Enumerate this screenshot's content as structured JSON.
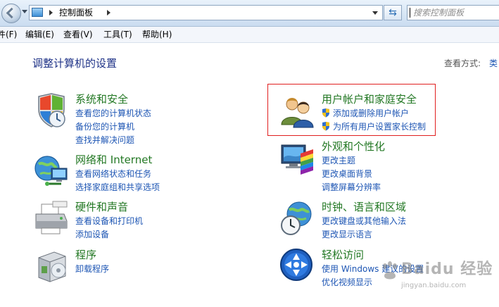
{
  "address_bar": {
    "breadcrumb": [
      "控制面板"
    ],
    "search_placeholder": "搜索控制面板"
  },
  "menu": {
    "file": "件(F)",
    "edit": "编辑(E)",
    "view": "查看(V)",
    "tools": "工具(T)",
    "help": "帮助(H)"
  },
  "main": {
    "title": "调整计算机的设置",
    "view_by_label": "查看方式:",
    "view_by_value": "类",
    "categories": [
      {
        "title": "系统和安全",
        "icon": "shield-icon",
        "links": [
          "查看您的计算机状态",
          "备份您的计算机",
          "查找并解决问题"
        ]
      },
      {
        "title": "网络和 Internet",
        "icon": "network-globe-icon",
        "links": [
          "查看网络状态和任务",
          "选择家庭组和共享选项"
        ]
      },
      {
        "title": "硬件和声音",
        "icon": "printer-icon",
        "links": [
          "查看设备和打印机",
          "添加设备"
        ]
      },
      {
        "title": "程序",
        "icon": "programs-box-icon",
        "links": [
          "卸载程序"
        ]
      },
      {
        "title": "用户帐户和家庭安全",
        "icon": "users-icon",
        "links": [
          "添加或删除用户帐户",
          "为所有用户设置家长控制"
        ]
      },
      {
        "title": "外观和个性化",
        "icon": "monitor-palette-icon",
        "links": [
          "更改主题",
          "更改桌面背景",
          "调整屏幕分辨率"
        ]
      },
      {
        "title": "时钟、语言和区域",
        "icon": "clock-globe-icon",
        "links": [
          "更改键盘或其他输入法",
          "更改显示语言"
        ]
      },
      {
        "title": "轻松访问",
        "icon": "ease-of-access-icon",
        "links": [
          "使用 Windows 建议的设置",
          "优化视频显示"
        ]
      }
    ]
  },
  "watermark": {
    "main": "Baidu 经验",
    "sub": "jingyan.baidu.com"
  },
  "colors": {
    "category_title": "#237824",
    "link": "#1e56b4",
    "page_title": "#1e3287",
    "highlight": "#e01f1f"
  }
}
